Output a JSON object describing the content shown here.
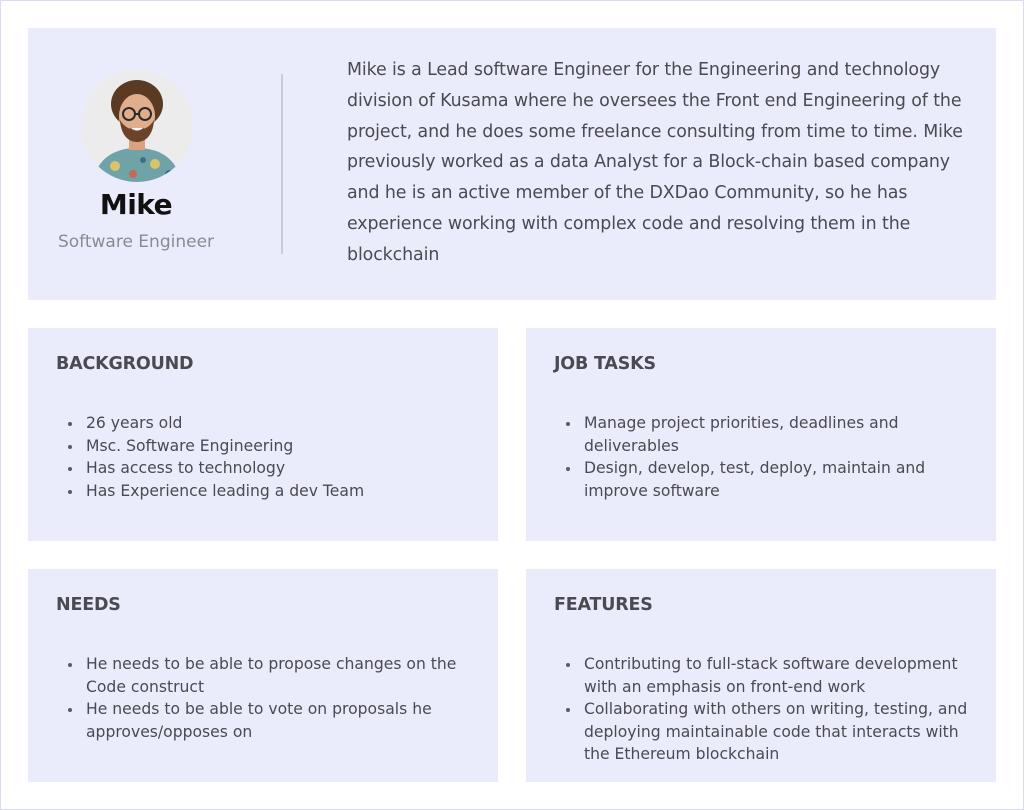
{
  "profile": {
    "name": "Mike",
    "role": "Software Engineer",
    "bio": "Mike is a Lead software Engineer for the Engineering and technology division of Kusama where he oversees the Front end Engineering of the project, and he does some freelance consulting from time to time. Mike previously worked as a data Analyst for a Block-chain based company and he is an active member of the DXDao Community, so he has experience working with complex code and resolving them in the blockchain"
  },
  "background": {
    "title": "BACKGROUND",
    "items": [
      "26 years old",
      "Msc. Software Engineering",
      "Has access to technology",
      "Has Experience leading a dev Team"
    ]
  },
  "job_tasks": {
    "title": "JOB TASKS",
    "items": [
      "Manage project priorities, deadlines and deliverables",
      "Design, develop, test, deploy, maintain and improve software"
    ]
  },
  "needs": {
    "title": "NEEDS",
    "items": [
      "He needs to be able to propose changes on the Code construct",
      "He needs to be able to vote on proposals  he approves/opposes on"
    ]
  },
  "features": {
    "title": "FEATURES",
    "items": [
      "Contributing to full-stack software development with an emphasis on front-end work",
      "Collaborating with others on writing, testing, and deploying maintainable code that interacts with the Ethereum blockchain"
    ]
  },
  "colors": {
    "card_background": "#ebecfb",
    "heading_text": "#4a4a52",
    "name_text": "#111111",
    "role_text": "#8a8a92"
  }
}
